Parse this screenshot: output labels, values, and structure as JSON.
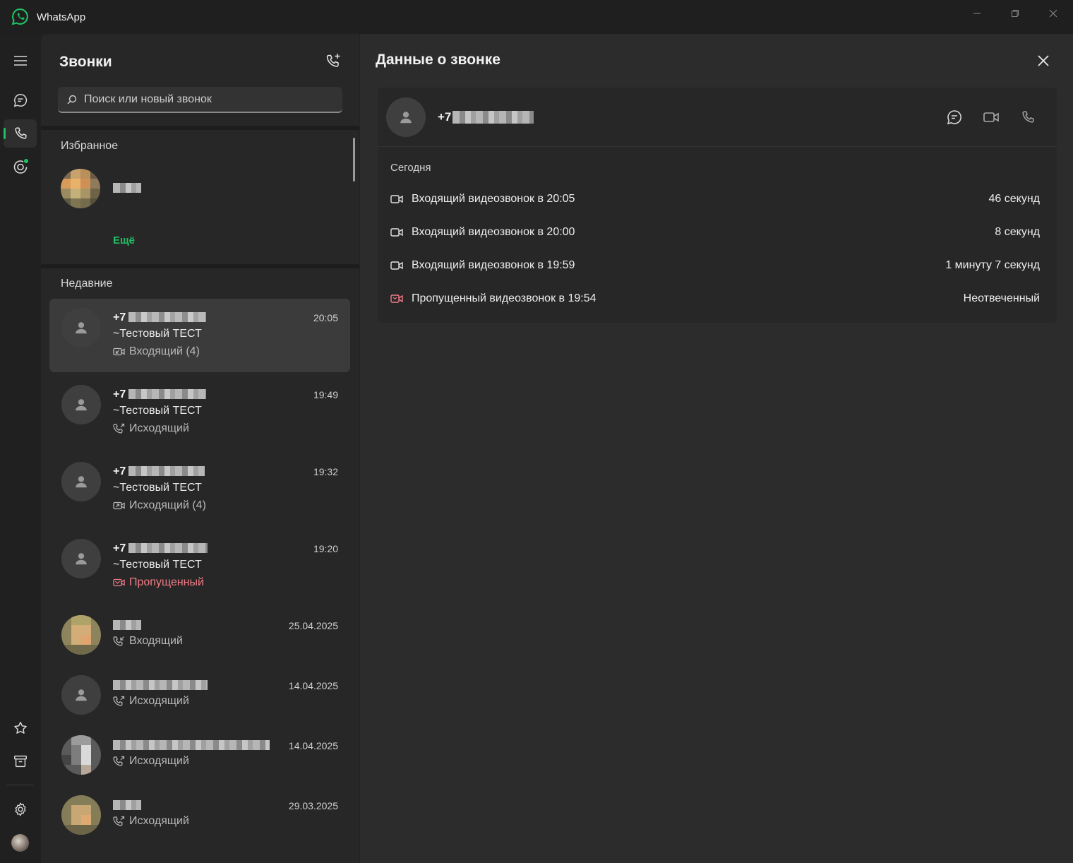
{
  "app": {
    "title": "WhatsApp"
  },
  "calls_panel": {
    "title": "Звонки",
    "search_placeholder": "Поиск или новый звонок",
    "favorites_label": "Избранное",
    "more_label": "Ещё",
    "recent_label": "Недавние",
    "rows": [
      {
        "number": "+7",
        "name": "~Тестовый ТЕСТ",
        "type": "Входящий (4)",
        "time": "20:05",
        "selected": true,
        "missed": false,
        "kind": "video-incoming"
      },
      {
        "number": "+7",
        "name": "~Тестовый ТЕСТ",
        "type": "Исходящий",
        "time": "19:49",
        "selected": false,
        "missed": false,
        "kind": "voice-outgoing"
      },
      {
        "number": "+7",
        "name": "~Тестовый ТЕСТ",
        "type": "Исходящий (4)",
        "time": "19:32",
        "selected": false,
        "missed": false,
        "kind": "video-outgoing"
      },
      {
        "number": "+7",
        "name": "~Тестовый ТЕСТ",
        "type": "Пропущенный",
        "time": "19:20",
        "selected": false,
        "missed": true,
        "kind": "video-missed"
      },
      {
        "number": "",
        "name": "",
        "type": "Входящий",
        "time": "25.04.2025",
        "selected": false,
        "missed": false,
        "kind": "voice-incoming"
      },
      {
        "number": "",
        "name": "",
        "type": "Исходящий",
        "time": "14.04.2025",
        "selected": false,
        "missed": false,
        "kind": "voice-outgoing"
      },
      {
        "number": "",
        "name": "",
        "type": "Исходящий",
        "time": "14.04.2025",
        "selected": false,
        "missed": false,
        "kind": "voice-outgoing"
      },
      {
        "number": "",
        "name": "",
        "type": "Исходящий",
        "time": "29.03.2025",
        "selected": false,
        "missed": false,
        "kind": "voice-outgoing"
      }
    ]
  },
  "details": {
    "title": "Данные о звонке",
    "number": "+7",
    "day_label": "Сегодня",
    "log": [
      {
        "text": "Входящий видеозвонок в 20:05",
        "duration": "46 секунд",
        "missed": false
      },
      {
        "text": "Входящий видеозвонок в 20:00",
        "duration": "8 секунд",
        "missed": false
      },
      {
        "text": "Входящий видеозвонок в 19:59",
        "duration": "1 минуту 7 секунд",
        "missed": false
      },
      {
        "text": "Пропущенный видеозвонок в 19:54",
        "duration": "Неотвеченный",
        "missed": true
      }
    ]
  },
  "colors": {
    "accent": "#21c063",
    "missed": "#f07b86"
  },
  "icons": {
    "rail": [
      "menu-icon",
      "chats-icon",
      "calls-icon",
      "status-icon",
      "starred-icon",
      "archive-icon",
      "settings-icon"
    ],
    "header": [
      "new-call-icon",
      "close-icon"
    ],
    "detail_actions": [
      "chat-icon",
      "video-call-icon",
      "voice-call-icon"
    ]
  }
}
